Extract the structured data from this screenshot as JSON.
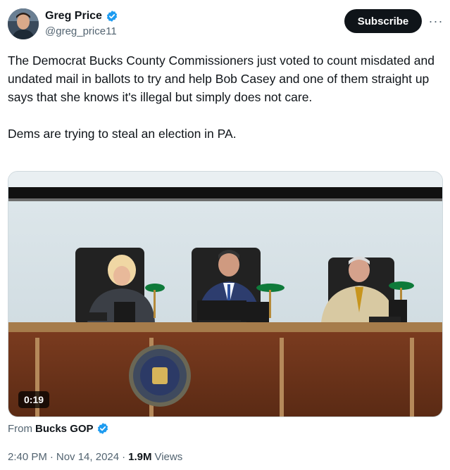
{
  "author": {
    "display_name": "Greg Price",
    "handle": "@greg_price11",
    "avatar_icon": "profile-photo"
  },
  "actions": {
    "subscribe_label": "Subscribe",
    "more_label": "···"
  },
  "tweet": {
    "paragraphs": [
      "The Democrat Bucks County Commissioners just voted to count misdated and undated mail in ballots to try and help Bob Casey and one of them straight up says that she knows it's illegal but simply does not care.",
      "Dems are trying to steal an election in PA."
    ]
  },
  "media": {
    "type": "video",
    "duration": "0:19"
  },
  "source": {
    "prefix": "From",
    "name": "Bucks GOP"
  },
  "meta": {
    "time": "2:40 PM",
    "separator": "·",
    "date": "Nov 14, 2024",
    "views_count": "1.9M",
    "views_label": "Views"
  },
  "colors": {
    "verified_blue": "#1d9bf0",
    "text_primary": "#0f1419",
    "text_secondary": "#536471",
    "button_dark": "#0f1419"
  }
}
